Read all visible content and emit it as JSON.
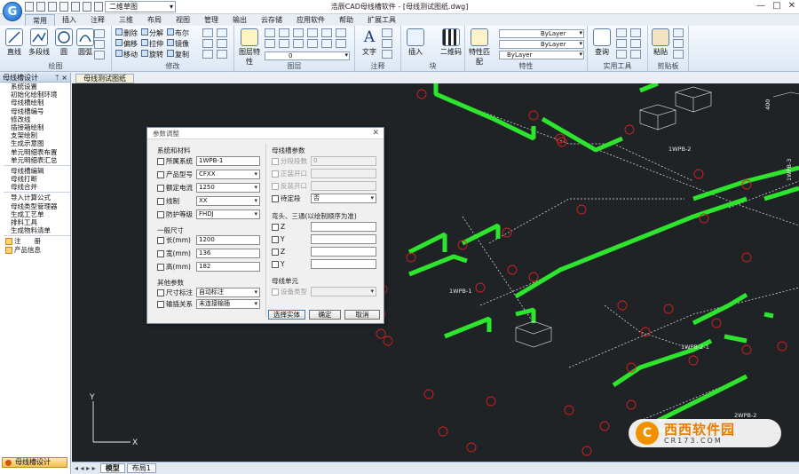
{
  "titlebar": {
    "app_logo": "G",
    "workspace": "二维草图",
    "title": "浩辰CAD母线槽软件 - [母线测试图纸.dwg]",
    "controls": [
      "—",
      "□",
      "✕"
    ]
  },
  "ribbon": {
    "tabs": [
      "常用",
      "插入",
      "注释",
      "三维",
      "布局",
      "视图",
      "管理",
      "输出",
      "云存储",
      "应用软件",
      "帮助",
      "扩展工具"
    ],
    "groups": {
      "draw": {
        "label": "绘图",
        "tools": [
          "直线",
          "多段线",
          "圆",
          "圆弧"
        ]
      },
      "modify": {
        "label": "修改",
        "row1": [
          "删除",
          "分解",
          "布尔"
        ],
        "row2": [
          "偏移",
          "拉伸",
          "镜像"
        ],
        "row3": [
          "移动",
          "旋转",
          "复制"
        ]
      },
      "layer": {
        "label": "图层",
        "tool": "图层特性",
        "layer_value": "0"
      },
      "annotation": {
        "label": "注释",
        "tool": "文字"
      },
      "block": {
        "label": "块",
        "tools": [
          "插入",
          "二维码"
        ]
      },
      "properties": {
        "label": "特性",
        "tool": "特性匹配",
        "linetype1": "ByLayer",
        "linetype2": "ByLayer",
        "color": "ByLayer"
      },
      "utilities": {
        "label": "实用工具",
        "tool": "查询"
      },
      "clipboard": {
        "label": "剪贴板",
        "tool": "粘贴"
      }
    }
  },
  "panel": {
    "title": "母线槽设计",
    "pin": "ᛘ ×",
    "items_group1": [
      "系统设置",
      "初始化绘制环境",
      "母线槽绘制",
      "母线槽编号",
      "修改线",
      "插接箱绘制",
      "支架绘制",
      "生成示意图",
      "单元明细表布置",
      "单元明细表汇总"
    ],
    "items_group2": [
      "母线槽编辑",
      "母线打断",
      "母线合并"
    ],
    "items_group3": [
      "导入计算公式",
      "母线类型管理器",
      "生成工艺单",
      "排料工具",
      "生成物料清单"
    ],
    "items_icons": [
      "注　　册",
      "产品信息"
    ],
    "bottom_button": "母线槽设计"
  },
  "document": {
    "tab": "母线测试图纸"
  },
  "canvas": {
    "labels": [
      "1WPB-1",
      "1WPB-2",
      "1WPB-2-1",
      "2WPB-2",
      "1WPB-3",
      "400"
    ],
    "ucs_x": "X",
    "ucs_y": "Y",
    "colors": {
      "background": "#1f2326",
      "busbar": "#2ee52e",
      "annotation": "#d81e1e",
      "wire": "#e8e8e8"
    }
  },
  "layout_bar": {
    "nav": "◂ ◂ ▸ ▸",
    "tabs": [
      "模型",
      "布局1"
    ]
  },
  "dialog": {
    "title": "参数调整",
    "close": "✕",
    "system_section": "系统和材料",
    "fields_left": [
      {
        "label": "所属系统",
        "value": "1WPB-1",
        "type": "text"
      },
      {
        "label": "产品型号",
        "value": "CFXX",
        "type": "select"
      },
      {
        "label": "额定电流",
        "value": "1250",
        "type": "select"
      },
      {
        "label": "线制",
        "value": "XX",
        "type": "select"
      },
      {
        "label": "防护等级",
        "value": "FHDJ",
        "type": "select"
      }
    ],
    "size_section": "一般尺寸",
    "sizes": [
      {
        "label": "长(mm)",
        "value": "1200"
      },
      {
        "label": "宽(mm)",
        "value": "136"
      },
      {
        "label": "高(mm)",
        "value": "182"
      }
    ],
    "other_section": "其他参数",
    "others": [
      {
        "label": "尺寸标注",
        "value": "自动标注"
      },
      {
        "label": "输插关系",
        "value": "未连接输插"
      }
    ],
    "busbar_section": "母线槽参数",
    "busbar_fields": [
      {
        "label": "分段段数",
        "value": "0",
        "disabled": true
      },
      {
        "label": "正装开口",
        "value": "",
        "disabled": true
      },
      {
        "label": "反装开口",
        "value": "",
        "disabled": true
      },
      {
        "label": "待定段",
        "value": "否",
        "disabled": false
      }
    ],
    "elbow_section": "弯头、三通(以绘制顺序为准)",
    "elbow_fields": [
      "Z",
      "Y",
      "Z",
      "Y"
    ],
    "unit_section": "母线单元",
    "unit_field": {
      "label": "设备类型",
      "value": ""
    },
    "buttons": [
      "选择实体",
      "确定",
      "取消"
    ]
  },
  "watermark": {
    "mark": "C",
    "main": "西西软件园",
    "sub": "CR173.COM"
  }
}
